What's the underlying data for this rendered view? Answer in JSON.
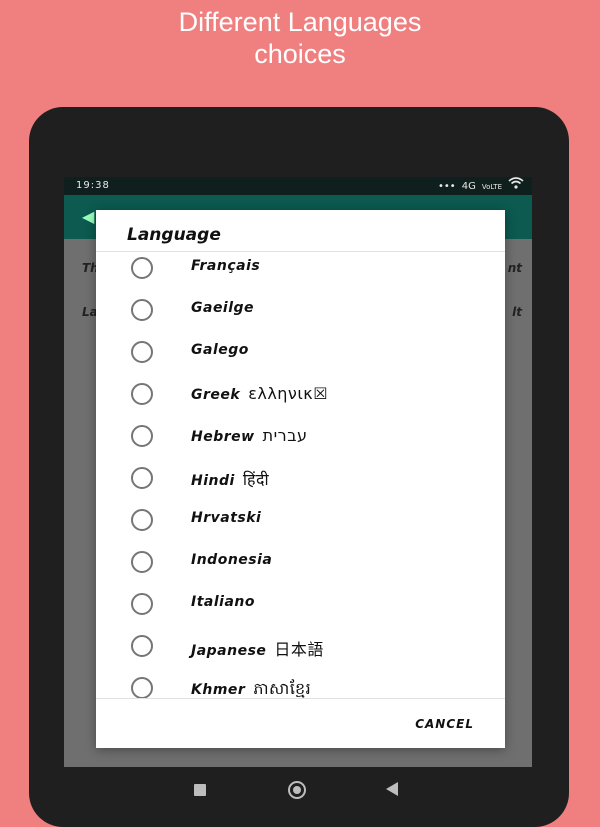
{
  "headline": {
    "line1": "Different Languages",
    "line2": "choices"
  },
  "statusbar": {
    "time": "19:38",
    "signal": "4G",
    "volte": "VoLTE"
  },
  "settings": {
    "row1": {
      "left": "Th",
      "right": "nt"
    },
    "row2": {
      "left": "La",
      "right": "lt"
    }
  },
  "dialog": {
    "title": "Language",
    "cancel_label": "CANCEL",
    "items": [
      {
        "label": "Français",
        "native": ""
      },
      {
        "label": "Gaeilge",
        "native": ""
      },
      {
        "label": "Galego",
        "native": ""
      },
      {
        "label": "Greek",
        "native": "ελληνικ☒"
      },
      {
        "label": "Hebrew",
        "native": "עברית"
      },
      {
        "label": "Hindi",
        "native": "हिंदी"
      },
      {
        "label": "Hrvatski",
        "native": ""
      },
      {
        "label": "Indonesia",
        "native": ""
      },
      {
        "label": "Italiano",
        "native": ""
      },
      {
        "label": "Japanese",
        "native": "日本語"
      },
      {
        "label": "Khmer",
        "native": "ភាសាខ្មែរ"
      }
    ]
  },
  "colors": {
    "background": "#f08080",
    "appbar": "#0c5a50",
    "device": "#1f1f1f"
  }
}
